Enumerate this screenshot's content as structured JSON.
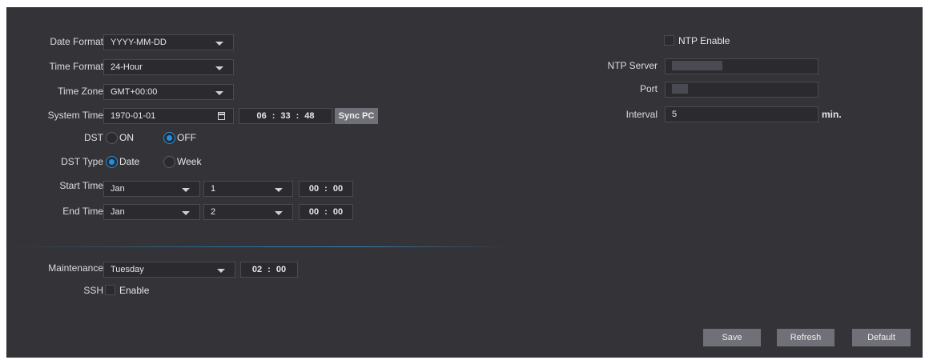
{
  "date_format": {
    "label": "Date Format",
    "value": "YYYY-MM-DD"
  },
  "time_format": {
    "label": "Time Format",
    "value": "24-Hour"
  },
  "time_zone": {
    "label": "Time Zone",
    "value": "GMT+00:00"
  },
  "system_time": {
    "label": "System Time",
    "date": "1970-01-01",
    "hour": "06",
    "minute": "33",
    "second": "48",
    "sync_label": "Sync PC"
  },
  "dst": {
    "label": "DST",
    "on_label": "ON",
    "off_label": "OFF",
    "selected": "OFF"
  },
  "dst_type": {
    "label": "DST Type",
    "date_label": "Date",
    "week_label": "Week",
    "selected": "Date"
  },
  "start_time": {
    "label": "Start Time",
    "month": "Jan",
    "day": "1",
    "hour": "00",
    "minute": "00"
  },
  "end_time": {
    "label": "End Time",
    "month": "Jan",
    "day": "2",
    "hour": "00",
    "minute": "00"
  },
  "maintenance": {
    "label": "Maintenance",
    "day": "Tuesday",
    "hour": "02",
    "minute": "00"
  },
  "ssh": {
    "label": "SSH",
    "enable_label": "Enable",
    "checked": false
  },
  "ntp": {
    "enable_label": "NTP Enable",
    "enabled": false,
    "server_label": "NTP Server",
    "port_label": "Port",
    "interval_label": "Interval",
    "interval_value": "5",
    "interval_unit": "min."
  },
  "buttons": {
    "save": "Save",
    "refresh": "Refresh",
    "default": "Default"
  },
  "colors": {
    "panel_bg": "#343438",
    "field_bg": "#2b2b2f",
    "accent": "#1f8fe0",
    "button_bg": "#707078"
  }
}
